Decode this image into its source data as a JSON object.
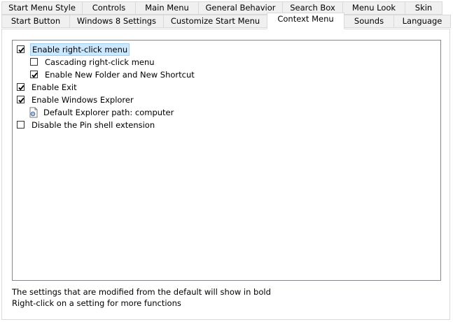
{
  "tabs_row1": [
    {
      "label": "Start Menu Style"
    },
    {
      "label": "Controls"
    },
    {
      "label": "Main Menu"
    },
    {
      "label": "General Behavior"
    },
    {
      "label": "Search Box"
    },
    {
      "label": "Menu Look"
    },
    {
      "label": "Skin"
    }
  ],
  "tabs_row2": [
    {
      "label": "Start Button"
    },
    {
      "label": "Windows 8 Settings"
    },
    {
      "label": "Customize Start Menu"
    },
    {
      "label": "Context Menu",
      "active": true
    },
    {
      "label": "Sounds"
    },
    {
      "label": "Language"
    }
  ],
  "settings": [
    {
      "label": "Enable right-click menu",
      "checked": true,
      "level": 0,
      "selected": true
    },
    {
      "label": "Cascading right-click menu",
      "checked": false,
      "level": 1
    },
    {
      "label": "Enable New Folder and New Shortcut",
      "checked": true,
      "level": 1
    },
    {
      "label": "Enable Exit",
      "checked": true,
      "level": 0
    },
    {
      "label": "Enable Windows Explorer",
      "checked": true,
      "level": 0
    },
    {
      "label": "Default Explorer path: computer",
      "icon": "document-settings-icon",
      "level": 1
    },
    {
      "label": "Disable the Pin shell extension",
      "checked": false,
      "level": 0
    }
  ],
  "footer": {
    "line1": "The settings that are modified from the default will show in bold",
    "line2": "Right-click on a setting for more functions"
  }
}
